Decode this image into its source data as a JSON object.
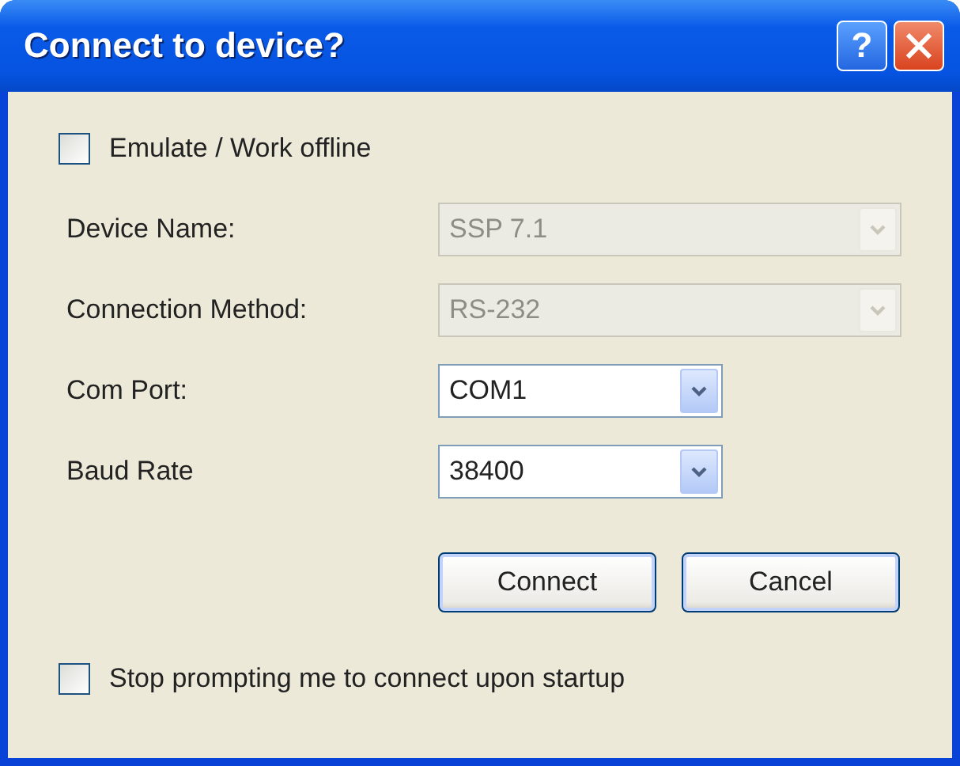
{
  "window": {
    "title": "Connect to device?",
    "help_label": "?"
  },
  "offline_checkbox": {
    "label": "Emulate / Work offline",
    "checked": false
  },
  "fields": [
    {
      "label": "Device Name:",
      "value": "SSP 7.1",
      "disabled": true
    },
    {
      "label": "Connection Method:",
      "value": "RS-232",
      "disabled": true
    },
    {
      "label": "Com Port:",
      "value": "COM1",
      "disabled": false
    },
    {
      "label": "Baud Rate",
      "value": "38400",
      "disabled": false
    }
  ],
  "buttons": [
    "Connect",
    "Cancel"
  ],
  "startup_checkbox": {
    "label": "Stop prompting me to connect upon startup",
    "checked": false
  }
}
